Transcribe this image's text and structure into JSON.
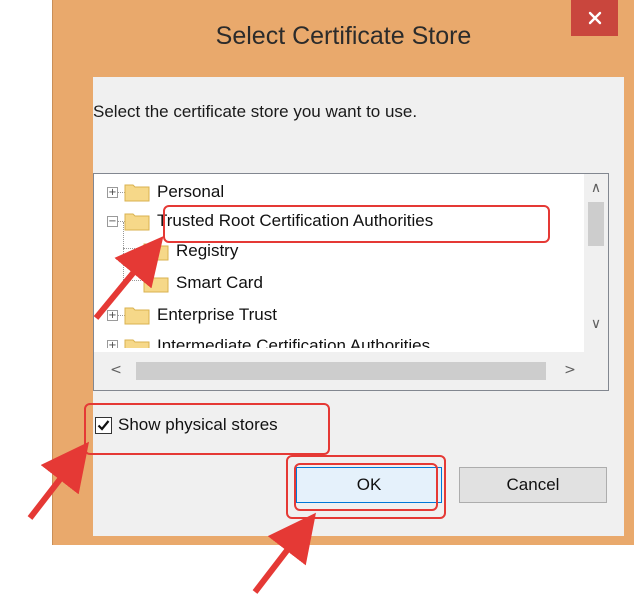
{
  "window": {
    "title": "Select Certificate Store"
  },
  "dialog": {
    "instruction": "Select the certificate store you want to use.",
    "tree": {
      "items": [
        {
          "label": "Personal",
          "expander": "+"
        },
        {
          "label": "Trusted Root Certification Authorities",
          "expander": "−"
        },
        {
          "label": "Registry"
        },
        {
          "label": "Smart Card"
        },
        {
          "label": "Enterprise Trust",
          "expander": "+"
        },
        {
          "label": "Intermediate Certification Authorities",
          "expander": "+"
        }
      ]
    },
    "scroll": {
      "up": "∧",
      "down": "∨",
      "left": "<",
      "right": ">"
    },
    "checkbox": {
      "label": "Show physical stores",
      "checked": true
    },
    "buttons": {
      "ok": "OK",
      "cancel": "Cancel"
    }
  },
  "colors": {
    "frame": "#e9a96c",
    "close": "#c9463d",
    "annotation": "#e53935"
  },
  "icons": [
    "close-icon",
    "folder-icon",
    "checkmark-icon",
    "expand-icon",
    "collapse-icon"
  ]
}
